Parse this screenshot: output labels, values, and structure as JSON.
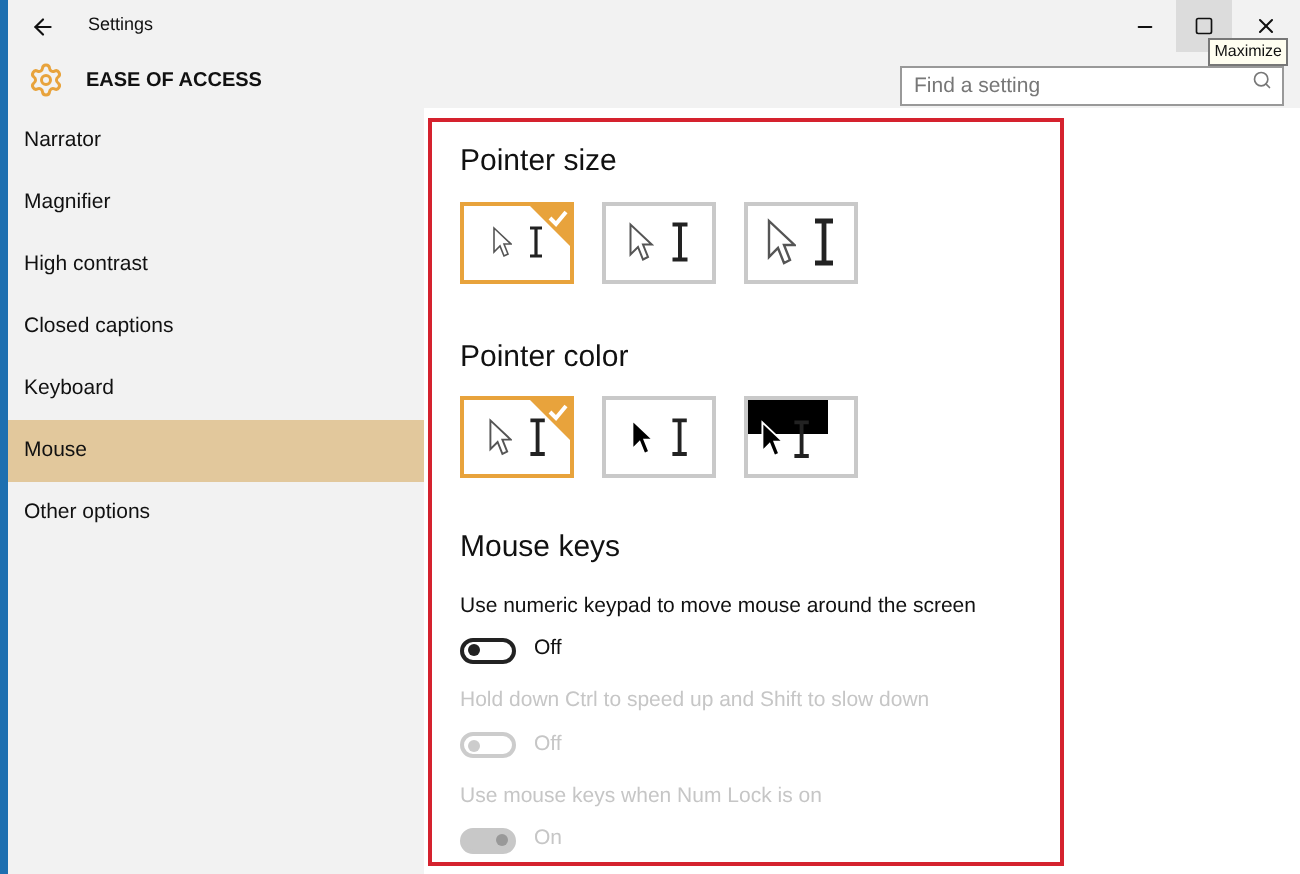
{
  "window": {
    "title": "Settings",
    "tooltip": "Maximize"
  },
  "header": {
    "title": "EASE OF ACCESS",
    "search": {
      "placeholder": "Find a setting"
    }
  },
  "sidebar": {
    "items": [
      {
        "label": "Narrator",
        "selected": false
      },
      {
        "label": "Magnifier",
        "selected": false
      },
      {
        "label": "High contrast",
        "selected": false
      },
      {
        "label": "Closed captions",
        "selected": false
      },
      {
        "label": "Keyboard",
        "selected": false
      },
      {
        "label": "Mouse",
        "selected": true
      },
      {
        "label": "Other options",
        "selected": false
      }
    ]
  },
  "pointer_size": {
    "title": "Pointer size",
    "options": [
      {
        "kind": "small",
        "selected": true
      },
      {
        "kind": "medium",
        "selected": false
      },
      {
        "kind": "large",
        "selected": false
      }
    ]
  },
  "pointer_color": {
    "title": "Pointer color",
    "options": [
      {
        "kind": "white",
        "selected": true
      },
      {
        "kind": "black",
        "selected": false
      },
      {
        "kind": "inverted",
        "selected": false
      }
    ]
  },
  "mouse_keys": {
    "title": "Mouse keys",
    "settings": [
      {
        "label": "Use numeric keypad to move mouse around the screen",
        "on": false,
        "disabled": false,
        "state": "Off"
      },
      {
        "label": "Hold down Ctrl to speed up and Shift to slow down",
        "on": false,
        "disabled": true,
        "state": "Off"
      },
      {
        "label": "Use mouse keys when Num Lock is on",
        "on": true,
        "disabled": true,
        "state": "On"
      }
    ]
  }
}
